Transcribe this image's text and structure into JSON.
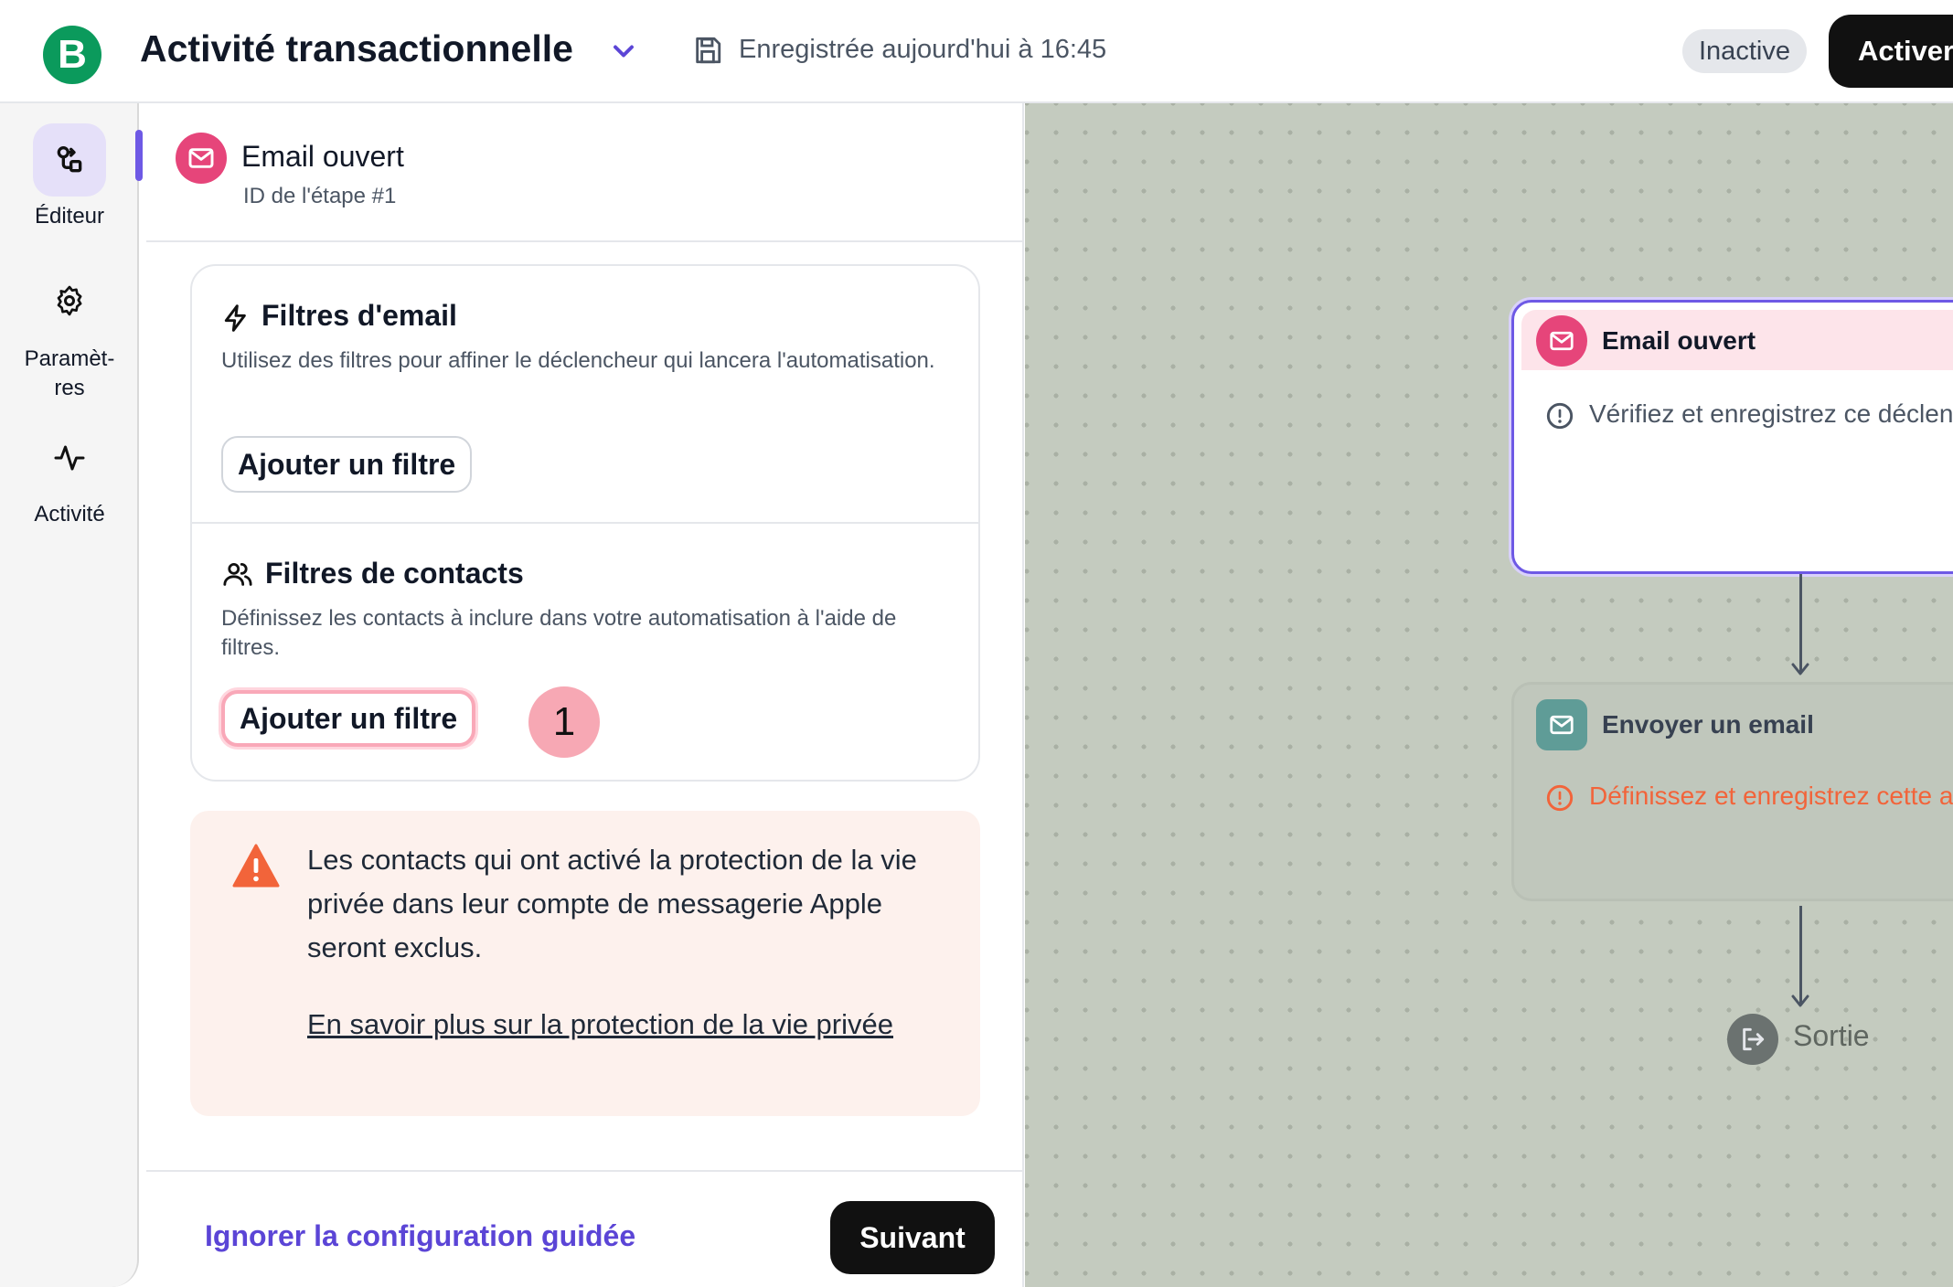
{
  "app": {
    "logo_letter": "B",
    "workflow_title": "Activité transactionnelle",
    "save_status": "Enregistrée aujourd'hui à 16:45",
    "status_badge": "Inactive",
    "activate_label": "Activer"
  },
  "rail": {
    "items": [
      {
        "label": "Éditeur",
        "icon": "flow-editor-icon",
        "active": true
      },
      {
        "label": "Paramèt-\nres",
        "icon": "gear-icon",
        "active": false
      },
      {
        "label": "Activité",
        "icon": "activity-pulse-icon",
        "active": false
      }
    ]
  },
  "panel": {
    "step_title": "Email ouvert",
    "step_id": "ID de l'étape #1",
    "email_filters": {
      "title": "Filtres d'email",
      "description": "Utilisez des filtres pour affiner le déclencheur qui lancera l'automatisation.",
      "button": "Ajouter un filtre"
    },
    "contact_filters": {
      "title": "Filtres de contacts",
      "description": "Définissez les contacts à inclure dans votre automatisation à l'aide de filtres.",
      "button": "Ajouter un filtre",
      "callout_number": "1"
    },
    "warning": {
      "text": "Les contacts qui ont activé la protection de la vie privée dans leur compte de messagerie Apple seront exclus.",
      "link": "En savoir plus sur la protection de la vie privée"
    },
    "footer": {
      "skip_label": "Ignorer la configuration guidée",
      "next_label": "Suivant"
    }
  },
  "canvas": {
    "trigger_node": {
      "title": "Email ouvert",
      "message": "Vérifiez et enregistrez ce déclencheur"
    },
    "email_node": {
      "title": "Envoyer un email",
      "message": "Définissez et enregistrez cette action"
    },
    "exit_label": "Sortie"
  },
  "colors": {
    "accent": "#6e59e5",
    "brand": "#0b9a5c",
    "trigger_pink": "#e6457a",
    "warning_orange": "#f2643a"
  }
}
